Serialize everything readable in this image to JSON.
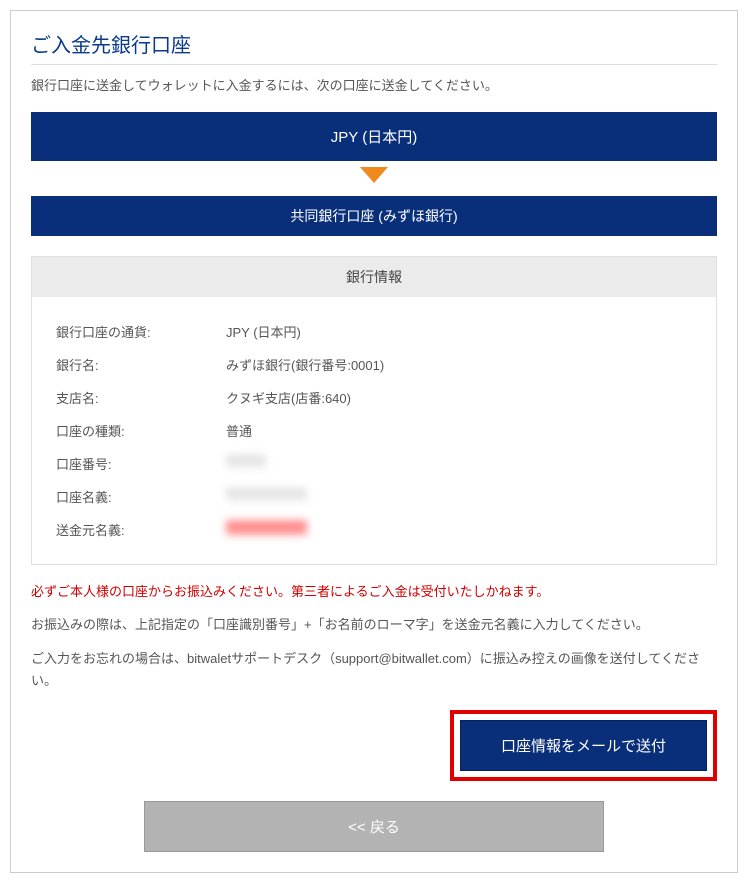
{
  "title": "ご入金先銀行口座",
  "subtitle": "銀行口座に送金してウォレットに入金するには、次の口座に送金してください。",
  "currencyBanner": "JPY (日本円)",
  "bankBanner": "共同銀行口座 (みずほ銀行)",
  "infoHeader": "銀行情報",
  "rows": [
    {
      "label": "銀行口座の通貨:",
      "value": "JPY (日本円)"
    },
    {
      "label": "銀行名:",
      "value": "みずほ銀行(銀行番号:0001)"
    },
    {
      "label": "支店名:",
      "value": "クヌギ支店(店番:640)"
    },
    {
      "label": "口座の種類:",
      "value": "普通"
    },
    {
      "label": "口座番号:",
      "value": "********"
    },
    {
      "label": "口座名義:",
      "value": "****************"
    },
    {
      "label": "送金元名義:",
      "value": "****************"
    }
  ],
  "warning": "必ずご本人様の口座からお振込みください。第三者によるご入金は受付いたしかねます。",
  "note1": "お振込みの際は、上記指定の「口座識別番号」+「お名前のローマ字」を送金元名義に入力してください。",
  "note2": "ご入力をお忘れの場合は、bitwaletサポートデスク（support@bitwallet.com）に振込み控えの画像を送付してください。",
  "sendButton": "口座情報をメールで送付",
  "backButton": "<< 戻る"
}
